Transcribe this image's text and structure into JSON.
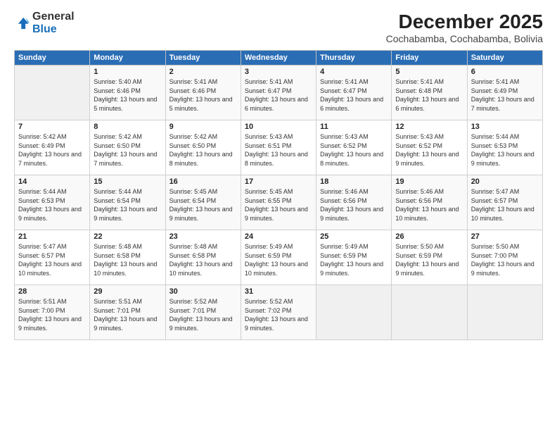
{
  "logo": {
    "general": "General",
    "blue": "Blue"
  },
  "header": {
    "month_year": "December 2025",
    "location": "Cochabamba, Cochabamba, Bolivia"
  },
  "days_of_week": [
    "Sunday",
    "Monday",
    "Tuesday",
    "Wednesday",
    "Thursday",
    "Friday",
    "Saturday"
  ],
  "weeks": [
    [
      {
        "day": "",
        "sunrise": "",
        "sunset": "",
        "daylight": ""
      },
      {
        "day": "1",
        "sunrise": "Sunrise: 5:40 AM",
        "sunset": "Sunset: 6:46 PM",
        "daylight": "Daylight: 13 hours and 5 minutes."
      },
      {
        "day": "2",
        "sunrise": "Sunrise: 5:41 AM",
        "sunset": "Sunset: 6:46 PM",
        "daylight": "Daylight: 13 hours and 5 minutes."
      },
      {
        "day": "3",
        "sunrise": "Sunrise: 5:41 AM",
        "sunset": "Sunset: 6:47 PM",
        "daylight": "Daylight: 13 hours and 6 minutes."
      },
      {
        "day": "4",
        "sunrise": "Sunrise: 5:41 AM",
        "sunset": "Sunset: 6:47 PM",
        "daylight": "Daylight: 13 hours and 6 minutes."
      },
      {
        "day": "5",
        "sunrise": "Sunrise: 5:41 AM",
        "sunset": "Sunset: 6:48 PM",
        "daylight": "Daylight: 13 hours and 6 minutes."
      },
      {
        "day": "6",
        "sunrise": "Sunrise: 5:41 AM",
        "sunset": "Sunset: 6:49 PM",
        "daylight": "Daylight: 13 hours and 7 minutes."
      }
    ],
    [
      {
        "day": "7",
        "sunrise": "Sunrise: 5:42 AM",
        "sunset": "Sunset: 6:49 PM",
        "daylight": "Daylight: 13 hours and 7 minutes."
      },
      {
        "day": "8",
        "sunrise": "Sunrise: 5:42 AM",
        "sunset": "Sunset: 6:50 PM",
        "daylight": "Daylight: 13 hours and 7 minutes."
      },
      {
        "day": "9",
        "sunrise": "Sunrise: 5:42 AM",
        "sunset": "Sunset: 6:50 PM",
        "daylight": "Daylight: 13 hours and 8 minutes."
      },
      {
        "day": "10",
        "sunrise": "Sunrise: 5:43 AM",
        "sunset": "Sunset: 6:51 PM",
        "daylight": "Daylight: 13 hours and 8 minutes."
      },
      {
        "day": "11",
        "sunrise": "Sunrise: 5:43 AM",
        "sunset": "Sunset: 6:52 PM",
        "daylight": "Daylight: 13 hours and 8 minutes."
      },
      {
        "day": "12",
        "sunrise": "Sunrise: 5:43 AM",
        "sunset": "Sunset: 6:52 PM",
        "daylight": "Daylight: 13 hours and 9 minutes."
      },
      {
        "day": "13",
        "sunrise": "Sunrise: 5:44 AM",
        "sunset": "Sunset: 6:53 PM",
        "daylight": "Daylight: 13 hours and 9 minutes."
      }
    ],
    [
      {
        "day": "14",
        "sunrise": "Sunrise: 5:44 AM",
        "sunset": "Sunset: 6:53 PM",
        "daylight": "Daylight: 13 hours and 9 minutes."
      },
      {
        "day": "15",
        "sunrise": "Sunrise: 5:44 AM",
        "sunset": "Sunset: 6:54 PM",
        "daylight": "Daylight: 13 hours and 9 minutes."
      },
      {
        "day": "16",
        "sunrise": "Sunrise: 5:45 AM",
        "sunset": "Sunset: 6:54 PM",
        "daylight": "Daylight: 13 hours and 9 minutes."
      },
      {
        "day": "17",
        "sunrise": "Sunrise: 5:45 AM",
        "sunset": "Sunset: 6:55 PM",
        "daylight": "Daylight: 13 hours and 9 minutes."
      },
      {
        "day": "18",
        "sunrise": "Sunrise: 5:46 AM",
        "sunset": "Sunset: 6:56 PM",
        "daylight": "Daylight: 13 hours and 9 minutes."
      },
      {
        "day": "19",
        "sunrise": "Sunrise: 5:46 AM",
        "sunset": "Sunset: 6:56 PM",
        "daylight": "Daylight: 13 hours and 10 minutes."
      },
      {
        "day": "20",
        "sunrise": "Sunrise: 5:47 AM",
        "sunset": "Sunset: 6:57 PM",
        "daylight": "Daylight: 13 hours and 10 minutes."
      }
    ],
    [
      {
        "day": "21",
        "sunrise": "Sunrise: 5:47 AM",
        "sunset": "Sunset: 6:57 PM",
        "daylight": "Daylight: 13 hours and 10 minutes."
      },
      {
        "day": "22",
        "sunrise": "Sunrise: 5:48 AM",
        "sunset": "Sunset: 6:58 PM",
        "daylight": "Daylight: 13 hours and 10 minutes."
      },
      {
        "day": "23",
        "sunrise": "Sunrise: 5:48 AM",
        "sunset": "Sunset: 6:58 PM",
        "daylight": "Daylight: 13 hours and 10 minutes."
      },
      {
        "day": "24",
        "sunrise": "Sunrise: 5:49 AM",
        "sunset": "Sunset: 6:59 PM",
        "daylight": "Daylight: 13 hours and 10 minutes."
      },
      {
        "day": "25",
        "sunrise": "Sunrise: 5:49 AM",
        "sunset": "Sunset: 6:59 PM",
        "daylight": "Daylight: 13 hours and 9 minutes."
      },
      {
        "day": "26",
        "sunrise": "Sunrise: 5:50 AM",
        "sunset": "Sunset: 6:59 PM",
        "daylight": "Daylight: 13 hours and 9 minutes."
      },
      {
        "day": "27",
        "sunrise": "Sunrise: 5:50 AM",
        "sunset": "Sunset: 7:00 PM",
        "daylight": "Daylight: 13 hours and 9 minutes."
      }
    ],
    [
      {
        "day": "28",
        "sunrise": "Sunrise: 5:51 AM",
        "sunset": "Sunset: 7:00 PM",
        "daylight": "Daylight: 13 hours and 9 minutes."
      },
      {
        "day": "29",
        "sunrise": "Sunrise: 5:51 AM",
        "sunset": "Sunset: 7:01 PM",
        "daylight": "Daylight: 13 hours and 9 minutes."
      },
      {
        "day": "30",
        "sunrise": "Sunrise: 5:52 AM",
        "sunset": "Sunset: 7:01 PM",
        "daylight": "Daylight: 13 hours and 9 minutes."
      },
      {
        "day": "31",
        "sunrise": "Sunrise: 5:52 AM",
        "sunset": "Sunset: 7:02 PM",
        "daylight": "Daylight: 13 hours and 9 minutes."
      },
      {
        "day": "",
        "sunrise": "",
        "sunset": "",
        "daylight": ""
      },
      {
        "day": "",
        "sunrise": "",
        "sunset": "",
        "daylight": ""
      },
      {
        "day": "",
        "sunrise": "",
        "sunset": "",
        "daylight": ""
      }
    ]
  ]
}
